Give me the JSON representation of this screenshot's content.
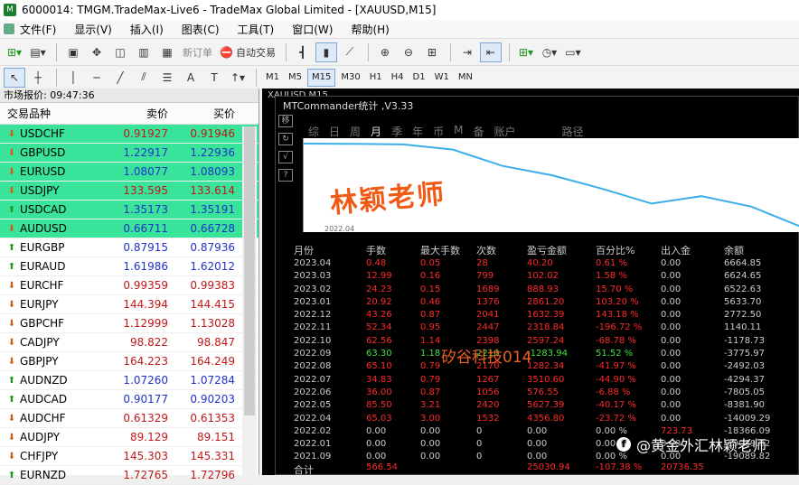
{
  "window": {
    "title": "6000014: TMGM.TradeMax-Live6 - TradeMax Global Limited - [XAUUSD,M15]"
  },
  "menu": [
    "文件(F)",
    "显示(V)",
    "插入(I)",
    "图表(C)",
    "工具(T)",
    "窗口(W)",
    "帮助(H)"
  ],
  "toolbar": {
    "new_order": "新订单",
    "auto_trade": "自动交易"
  },
  "timeframes": [
    "M1",
    "M5",
    "M15",
    "M30",
    "H1",
    "H4",
    "D1",
    "W1",
    "MN"
  ],
  "timeframe_selected": "M15",
  "market_watch": {
    "header": "市场报价: 09:47:36",
    "col_symbol": "交易品种",
    "col_bid": "卖价",
    "col_ask": "买价",
    "rows": [
      {
        "symbol": "USDCHF",
        "bid": "0.91927",
        "ask": "0.91946",
        "dir": "down",
        "hl": true,
        "color": "red"
      },
      {
        "symbol": "GBPUSD",
        "bid": "1.22917",
        "ask": "1.22936",
        "dir": "down",
        "hl": true,
        "color": "blue"
      },
      {
        "symbol": "EURUSD",
        "bid": "1.08077",
        "ask": "1.08093",
        "dir": "down",
        "hl": true,
        "color": "blue"
      },
      {
        "symbol": "USDJPY",
        "bid": "133.595",
        "ask": "133.614",
        "dir": "down",
        "hl": true,
        "color": "red"
      },
      {
        "symbol": "USDCAD",
        "bid": "1.35173",
        "ask": "1.35191",
        "dir": "up",
        "hl": true,
        "color": "blue"
      },
      {
        "symbol": "AUDUSD",
        "bid": "0.66711",
        "ask": "0.66728",
        "dir": "down",
        "hl": true,
        "color": "blue"
      },
      {
        "symbol": "EURGBP",
        "bid": "0.87915",
        "ask": "0.87936",
        "dir": "up",
        "hl": false,
        "color": "blue"
      },
      {
        "symbol": "EURAUD",
        "bid": "1.61986",
        "ask": "1.62012",
        "dir": "up",
        "hl": false,
        "color": "blue"
      },
      {
        "symbol": "EURCHF",
        "bid": "0.99359",
        "ask": "0.99383",
        "dir": "down",
        "hl": false,
        "color": "red"
      },
      {
        "symbol": "EURJPY",
        "bid": "144.394",
        "ask": "144.415",
        "dir": "down",
        "hl": false,
        "color": "red"
      },
      {
        "symbol": "GBPCHF",
        "bid": "1.12999",
        "ask": "1.13028",
        "dir": "down",
        "hl": false,
        "color": "red"
      },
      {
        "symbol": "CADJPY",
        "bid": "98.822",
        "ask": "98.847",
        "dir": "down",
        "hl": false,
        "color": "red"
      },
      {
        "symbol": "GBPJPY",
        "bid": "164.223",
        "ask": "164.249",
        "dir": "down",
        "hl": false,
        "color": "red"
      },
      {
        "symbol": "AUDNZD",
        "bid": "1.07260",
        "ask": "1.07284",
        "dir": "up",
        "hl": false,
        "color": "blue"
      },
      {
        "symbol": "AUDCAD",
        "bid": "0.90177",
        "ask": "0.90203",
        "dir": "up",
        "hl": false,
        "color": "blue"
      },
      {
        "symbol": "AUDCHF",
        "bid": "0.61329",
        "ask": "0.61353",
        "dir": "down",
        "hl": false,
        "color": "red"
      },
      {
        "symbol": "AUDJPY",
        "bid": "89.129",
        "ask": "89.151",
        "dir": "down",
        "hl": false,
        "color": "red"
      },
      {
        "symbol": "CHFJPY",
        "bid": "145.303",
        "ask": "145.331",
        "dir": "down",
        "hl": false,
        "color": "red"
      },
      {
        "symbol": "EURNZD",
        "bid": "1.72765",
        "ask": "1.72796",
        "dir": "up",
        "hl": false,
        "color": "red"
      }
    ]
  },
  "chart_window": {
    "tab": "XAUUSD,M15"
  },
  "mtc": {
    "title": "MTCommander统计 ,V3.33",
    "tabs": [
      "综",
      "日",
      "周",
      "月",
      "季",
      "年",
      "币",
      "M",
      "备",
      "账户"
    ],
    "tab_active": "月",
    "path_label": "路径",
    "plot_date": "2022.04",
    "watermark": "林颖老师",
    "watermark2": "矽谷科技014",
    "headers": [
      "月份",
      "手数",
      "最大手数",
      "次数",
      "盈亏金额",
      "百分比%",
      "出入金",
      "余额"
    ],
    "rows": [
      [
        "2023.04",
        "0.48",
        "0.05",
        "28",
        "40.20",
        "0.61 %",
        "0.00",
        "6664.85"
      ],
      [
        "2023.03",
        "12.99",
        "0.16",
        "799",
        "102.02",
        "1.58 %",
        "0.00",
        "6624.65"
      ],
      [
        "2023.02",
        "24.23",
        "0.15",
        "1689",
        "888.93",
        "15.70 %",
        "0.00",
        "6522.63"
      ],
      [
        "2023.01",
        "20.92",
        "0.46",
        "1376",
        "2861.20",
        "103.20 %",
        "0.00",
        "5633.70"
      ],
      [
        "2022.12",
        "43.26",
        "0.87",
        "2041",
        "1632.39",
        "143.18 %",
        "0.00",
        "2772.50"
      ],
      [
        "2022.11",
        "52.34",
        "0.95",
        "2447",
        "2318.84",
        "-196.72 %",
        "0.00",
        "1140.11"
      ],
      [
        "2022.10",
        "62.56",
        "1.14",
        "2398",
        "2597.24",
        "-68.78 %",
        "0.00",
        "-1178.73"
      ],
      [
        "2022.09",
        "63.30",
        "1.18",
        "2210",
        "-1283.94",
        "51.52 %",
        "0.00",
        "-3775.97"
      ],
      [
        "2022.08",
        "65.10",
        "0.79",
        "2170",
        "1282.34",
        "-41.97 %",
        "0.00",
        "-2492.03"
      ],
      [
        "2022.07",
        "34.83",
        "0.79",
        "1267",
        "3510.60",
        "-44.90 %",
        "0.00",
        "-4294.37"
      ],
      [
        "2022.06",
        "36.00",
        "0.87",
        "1056",
        "576.55",
        "-6.88 %",
        "0.00",
        "-7805.05"
      ],
      [
        "2022.05",
        "85.50",
        "3.21",
        "2420",
        "5627.39",
        "-40.17 %",
        "0.00",
        "-8381.90"
      ],
      [
        "2022.04",
        "65.03",
        "3.00",
        "1532",
        "4356.80",
        "-23.72 %",
        "0.00",
        "-14009.29"
      ],
      [
        "2022.02",
        "0.00",
        "0.00",
        "0",
        "0.00",
        "0.00 %",
        "723.73",
        "-18366.09"
      ],
      [
        "2022.01",
        "0.00",
        "0.00",
        "0",
        "0.00",
        "0.00 %",
        "0.00",
        "-19089.82"
      ],
      [
        "2021.09",
        "0.00",
        "0.00",
        "0",
        "0.00",
        "0.00 %",
        "0.00",
        "-19089.82"
      ]
    ],
    "row_colors": [
      "n",
      "n",
      "n",
      "n",
      "n",
      "n",
      "n",
      "g",
      "n",
      "n",
      "n",
      "n",
      "n",
      "w",
      "w",
      "w"
    ],
    "total_label": "合计",
    "total": [
      "566.54",
      "",
      "",
      "25030.94",
      "-107.38 %",
      "20736.35",
      ""
    ],
    "curve_points": [
      6664.85,
      6624.65,
      6522.63,
      5633.7,
      2772.5,
      1140.11,
      -1178.73,
      -3775.97,
      -2492.03,
      -4294.37,
      -7805.05
    ]
  },
  "footer_watermark": "@黄金外汇林颖老师",
  "footer_icon": "facebook-icon"
}
